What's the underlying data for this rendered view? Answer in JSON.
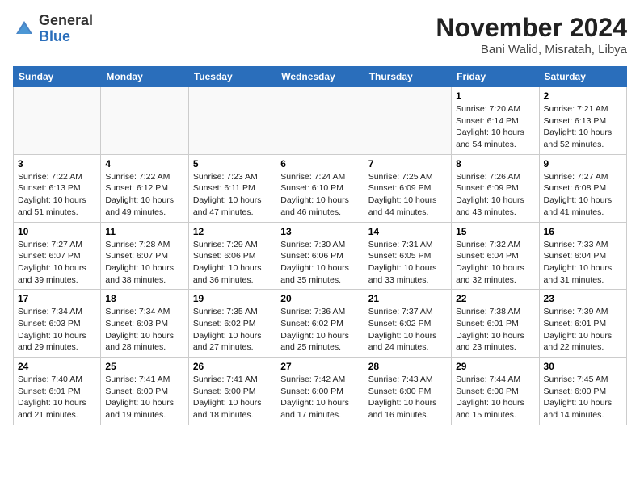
{
  "header": {
    "logo_line1": "General",
    "logo_line2": "Blue",
    "month": "November 2024",
    "location": "Bani Walid, Misratah, Libya"
  },
  "weekdays": [
    "Sunday",
    "Monday",
    "Tuesday",
    "Wednesday",
    "Thursday",
    "Friday",
    "Saturday"
  ],
  "weeks": [
    [
      {
        "day": "",
        "info": ""
      },
      {
        "day": "",
        "info": ""
      },
      {
        "day": "",
        "info": ""
      },
      {
        "day": "",
        "info": ""
      },
      {
        "day": "",
        "info": ""
      },
      {
        "day": "1",
        "info": "Sunrise: 7:20 AM\nSunset: 6:14 PM\nDaylight: 10 hours\nand 54 minutes."
      },
      {
        "day": "2",
        "info": "Sunrise: 7:21 AM\nSunset: 6:13 PM\nDaylight: 10 hours\nand 52 minutes."
      }
    ],
    [
      {
        "day": "3",
        "info": "Sunrise: 7:22 AM\nSunset: 6:13 PM\nDaylight: 10 hours\nand 51 minutes."
      },
      {
        "day": "4",
        "info": "Sunrise: 7:22 AM\nSunset: 6:12 PM\nDaylight: 10 hours\nand 49 minutes."
      },
      {
        "day": "5",
        "info": "Sunrise: 7:23 AM\nSunset: 6:11 PM\nDaylight: 10 hours\nand 47 minutes."
      },
      {
        "day": "6",
        "info": "Sunrise: 7:24 AM\nSunset: 6:10 PM\nDaylight: 10 hours\nand 46 minutes."
      },
      {
        "day": "7",
        "info": "Sunrise: 7:25 AM\nSunset: 6:09 PM\nDaylight: 10 hours\nand 44 minutes."
      },
      {
        "day": "8",
        "info": "Sunrise: 7:26 AM\nSunset: 6:09 PM\nDaylight: 10 hours\nand 43 minutes."
      },
      {
        "day": "9",
        "info": "Sunrise: 7:27 AM\nSunset: 6:08 PM\nDaylight: 10 hours\nand 41 minutes."
      }
    ],
    [
      {
        "day": "10",
        "info": "Sunrise: 7:27 AM\nSunset: 6:07 PM\nDaylight: 10 hours\nand 39 minutes."
      },
      {
        "day": "11",
        "info": "Sunrise: 7:28 AM\nSunset: 6:07 PM\nDaylight: 10 hours\nand 38 minutes."
      },
      {
        "day": "12",
        "info": "Sunrise: 7:29 AM\nSunset: 6:06 PM\nDaylight: 10 hours\nand 36 minutes."
      },
      {
        "day": "13",
        "info": "Sunrise: 7:30 AM\nSunset: 6:06 PM\nDaylight: 10 hours\nand 35 minutes."
      },
      {
        "day": "14",
        "info": "Sunrise: 7:31 AM\nSunset: 6:05 PM\nDaylight: 10 hours\nand 33 minutes."
      },
      {
        "day": "15",
        "info": "Sunrise: 7:32 AM\nSunset: 6:04 PM\nDaylight: 10 hours\nand 32 minutes."
      },
      {
        "day": "16",
        "info": "Sunrise: 7:33 AM\nSunset: 6:04 PM\nDaylight: 10 hours\nand 31 minutes."
      }
    ],
    [
      {
        "day": "17",
        "info": "Sunrise: 7:34 AM\nSunset: 6:03 PM\nDaylight: 10 hours\nand 29 minutes."
      },
      {
        "day": "18",
        "info": "Sunrise: 7:34 AM\nSunset: 6:03 PM\nDaylight: 10 hours\nand 28 minutes."
      },
      {
        "day": "19",
        "info": "Sunrise: 7:35 AM\nSunset: 6:02 PM\nDaylight: 10 hours\nand 27 minutes."
      },
      {
        "day": "20",
        "info": "Sunrise: 7:36 AM\nSunset: 6:02 PM\nDaylight: 10 hours\nand 25 minutes."
      },
      {
        "day": "21",
        "info": "Sunrise: 7:37 AM\nSunset: 6:02 PM\nDaylight: 10 hours\nand 24 minutes."
      },
      {
        "day": "22",
        "info": "Sunrise: 7:38 AM\nSunset: 6:01 PM\nDaylight: 10 hours\nand 23 minutes."
      },
      {
        "day": "23",
        "info": "Sunrise: 7:39 AM\nSunset: 6:01 PM\nDaylight: 10 hours\nand 22 minutes."
      }
    ],
    [
      {
        "day": "24",
        "info": "Sunrise: 7:40 AM\nSunset: 6:01 PM\nDaylight: 10 hours\nand 21 minutes."
      },
      {
        "day": "25",
        "info": "Sunrise: 7:41 AM\nSunset: 6:00 PM\nDaylight: 10 hours\nand 19 minutes."
      },
      {
        "day": "26",
        "info": "Sunrise: 7:41 AM\nSunset: 6:00 PM\nDaylight: 10 hours\nand 18 minutes."
      },
      {
        "day": "27",
        "info": "Sunrise: 7:42 AM\nSunset: 6:00 PM\nDaylight: 10 hours\nand 17 minutes."
      },
      {
        "day": "28",
        "info": "Sunrise: 7:43 AM\nSunset: 6:00 PM\nDaylight: 10 hours\nand 16 minutes."
      },
      {
        "day": "29",
        "info": "Sunrise: 7:44 AM\nSunset: 6:00 PM\nDaylight: 10 hours\nand 15 minutes."
      },
      {
        "day": "30",
        "info": "Sunrise: 7:45 AM\nSunset: 6:00 PM\nDaylight: 10 hours\nand 14 minutes."
      }
    ]
  ]
}
